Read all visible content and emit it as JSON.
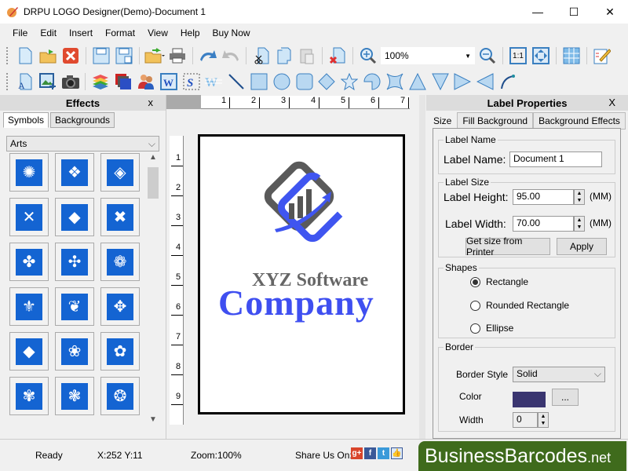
{
  "window": {
    "title": "DRPU LOGO Designer(Demo)-Document 1",
    "controls": {
      "minimize": "—",
      "maximize": "☐",
      "close": "✕"
    }
  },
  "menu": [
    "File",
    "Edit",
    "Insert",
    "Format",
    "View",
    "Help",
    "Buy Now"
  ],
  "toolbar1": {
    "icons": [
      "new-document-icon",
      "open-folder-icon",
      "close-document-icon",
      "save-icon",
      "save-as-icon",
      "import-icon",
      "print-icon",
      "undo-icon",
      "redo-icon",
      "cut-icon",
      "copy-icon",
      "paste-icon",
      "delete-icon",
      "zoom-in-icon",
      "zoom-out-icon",
      "actual-size-icon",
      "fit-to-window-icon",
      "grid-icon",
      "edit-properties-icon"
    ],
    "zoom_value": "100%",
    "actual_size_label": "1:1"
  },
  "toolbar2": {
    "icons": [
      "text-icon",
      "insert-image-icon",
      "camera-icon",
      "layers-icon",
      "background-icon",
      "users-icon",
      "word-art-icon",
      "signature-icon",
      "watermark-icon",
      "line-icon",
      "rectangle-icon",
      "ellipse-icon",
      "rounded-rectangle-icon",
      "diamond-icon",
      "star-icon",
      "pie-icon",
      "four-point-star-icon",
      "triangle-up-icon",
      "triangle-down-icon",
      "triangle-right-icon",
      "triangle-left-icon",
      "arc-icon"
    ]
  },
  "effects_panel": {
    "title": "Effects",
    "close": "x",
    "tabs": [
      "Symbols",
      "Backgrounds"
    ],
    "active_tab": "Symbols",
    "category": "Arts",
    "symbols": [
      "triskelion",
      "celtic-knot-circle",
      "spiral-diamond",
      "celtic-cross-square",
      "celtic-diamond",
      "celtic-knot-x",
      "flower-cross",
      "swirl-pattern",
      "ornament-circle",
      "fleur-circle",
      "scroll-ornament",
      "leaf-cross",
      "fleur-diamond",
      "fan-leaf",
      "lotus-leaf",
      "ornament-13",
      "ornament-14",
      "ornament-15"
    ]
  },
  "canvas": {
    "hruler_ticks": [
      "1",
      "2",
      "3",
      "4",
      "5",
      "6",
      "7"
    ],
    "vruler_ticks": [
      "1",
      "2",
      "3",
      "4",
      "5",
      "6",
      "7",
      "8",
      "9"
    ],
    "logo": {
      "line1": "XYZ Software",
      "line2": "Company",
      "line1_color": "#666666",
      "line2_color": "#3f4ff0"
    }
  },
  "label_properties": {
    "title": "Label Properties",
    "close": "X",
    "tabs": [
      "Size",
      "Fill Background",
      "Background Effects"
    ],
    "active_tab": "Size",
    "label_name_group": "Label Name",
    "label_name_label": "Label Name:",
    "label_name_value": "Document 1",
    "label_size_group": "Label Size",
    "height_label": "Label Height:",
    "height_value": "95.00",
    "width_label": "Label Width:",
    "width_value": "70.00",
    "unit": "(MM)",
    "get_size_button": "Get size from Printer",
    "apply_button": "Apply",
    "shapes_group": "Shapes",
    "shapes": [
      {
        "label": "Rectangle",
        "selected": true
      },
      {
        "label": "Rounded Rectangle",
        "selected": false
      },
      {
        "label": "Ellipse",
        "selected": false
      }
    ],
    "border_group": "Border",
    "border_style_label": "Border Style",
    "border_style_value": "Solid",
    "color_label": "Color",
    "color_value": "#3a3570",
    "color_button": "...",
    "width_border_label": "Width",
    "width_border_value": "0"
  },
  "status": {
    "state": "Ready",
    "coords": "X:252  Y:11",
    "zoom": "Zoom:100%",
    "share_label": "Share Us On:",
    "social": [
      "google-plus-icon",
      "facebook-icon",
      "twitter-icon",
      "like-icon"
    ],
    "brand_main": "BusinessBarcodes",
    "brand_suffix": ".net"
  }
}
